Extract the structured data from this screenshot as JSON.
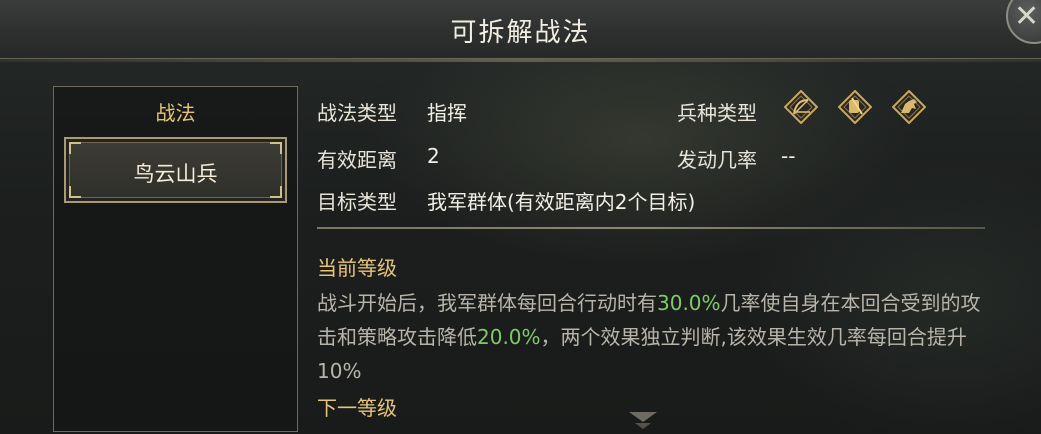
{
  "header": {
    "title": "可拆解战法"
  },
  "left_panel": {
    "header": "战法",
    "items": [
      {
        "label": "鸟云山兵"
      }
    ]
  },
  "info": {
    "tactic_type_label": "战法类型",
    "tactic_type_value": "指挥",
    "troop_type_label": "兵种类型",
    "troop_icons": [
      "archer-icon",
      "shield-infantry-icon",
      "cavalry-icon"
    ],
    "range_label": "有效距离",
    "range_value": "2",
    "trigger_rate_label": "发动几率",
    "trigger_rate_value": "--",
    "target_label": "目标类型",
    "target_value": "我军群体(有效距离内2个目标)"
  },
  "current_level": {
    "title": "当前等级",
    "desc_part1": "战斗开始后，我军群体每回合行动时有",
    "desc_hl1": "30.0%",
    "desc_part2": "几率使自身在本回合受到的攻击和策略攻击降低",
    "desc_hl2": "20.0%",
    "desc_part3": "，两个效果独立判断,该效果生效几率每回合提升10%"
  },
  "next_level": {
    "title": "下一等级"
  },
  "colors": {
    "accent_gold": "#e6c57a",
    "highlight_green": "#7fca6a",
    "panel_border": "#6e6a5c"
  }
}
